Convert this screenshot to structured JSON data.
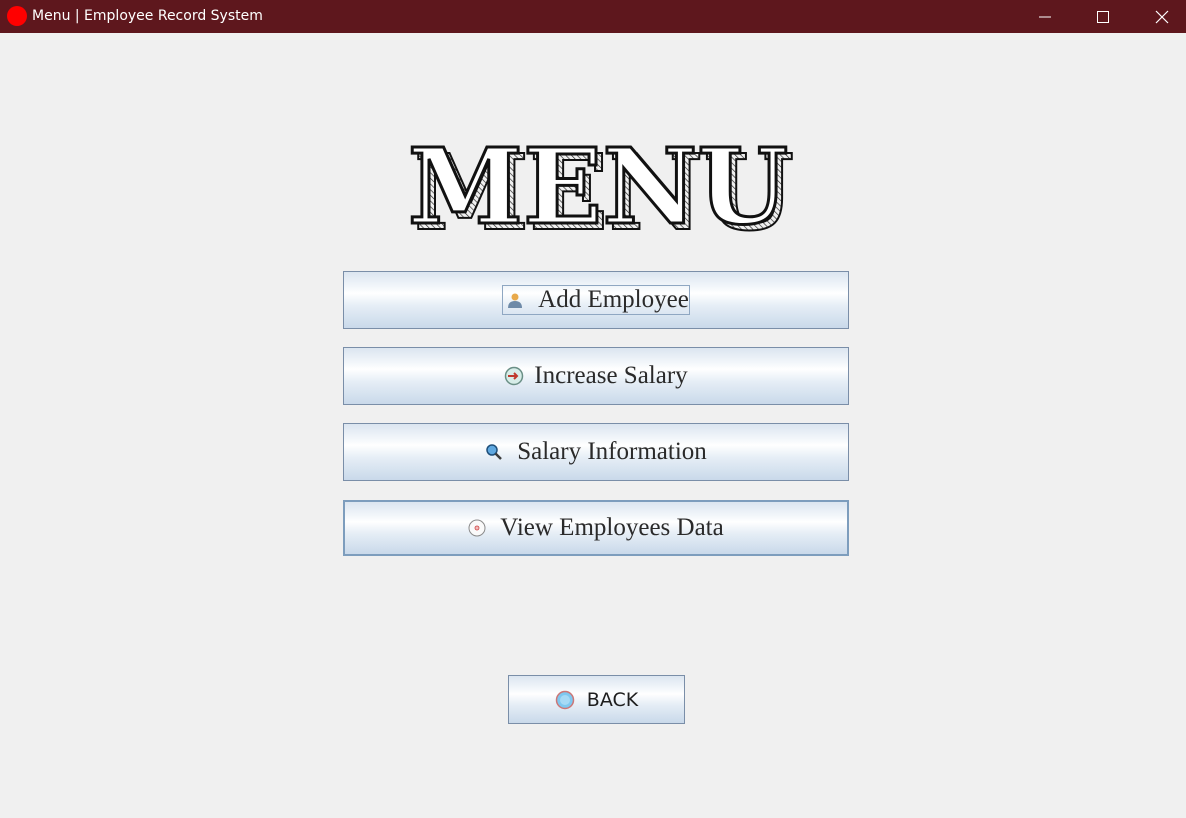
{
  "window": {
    "title": "Menu | Employee Record System",
    "accent_color": "#5e171d",
    "app_icon_color": "#ff0000"
  },
  "logo": {
    "text": "MENU"
  },
  "menu": {
    "items": [
      {
        "label": "Add Employee",
        "icon": "person-icon"
      },
      {
        "label": "Increase Salary",
        "icon": "arrow-circle-icon"
      },
      {
        "label": "Salary Information",
        "icon": "magnifier-icon"
      },
      {
        "label": "View Employees Data",
        "icon": "disc-icon"
      }
    ]
  },
  "footer": {
    "back_label": "BACK",
    "back_icon": "globe-icon"
  }
}
